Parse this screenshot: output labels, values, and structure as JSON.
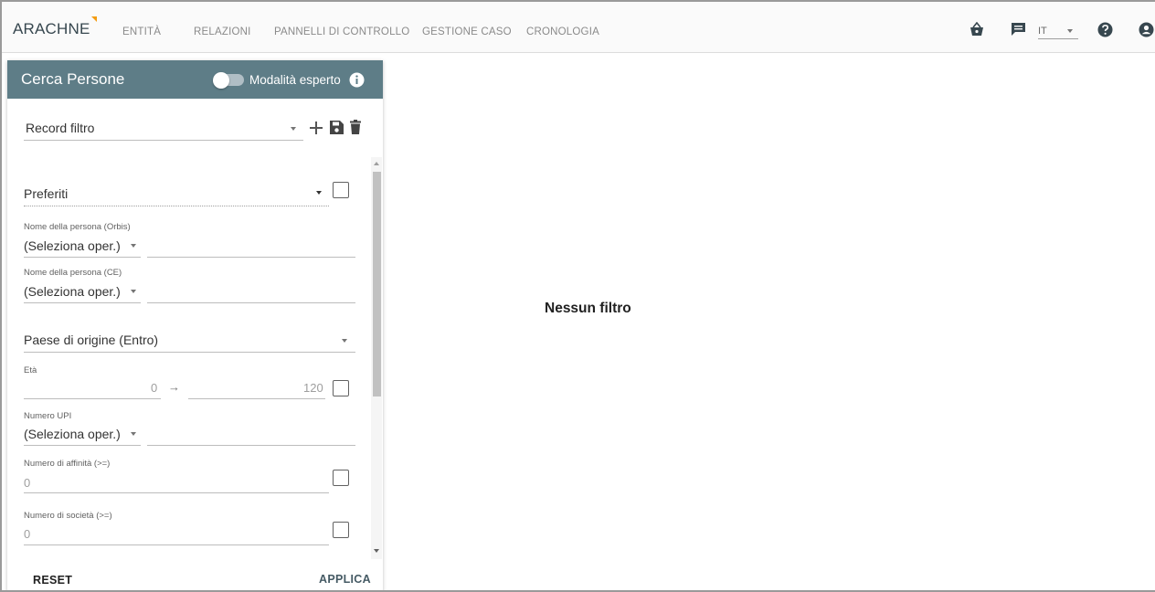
{
  "brand": "ARACHNE",
  "nav": [
    "ENTITÀ",
    "RELAZIONI",
    "PANNELLI DI CONTROLLO",
    "GESTIONE CASO",
    "CRONOLOGIA"
  ],
  "header_icons": [
    "basket-icon",
    "chat-icon",
    "help-icon",
    "account-icon"
  ],
  "language": {
    "value": "IT"
  },
  "panel": {
    "title": "Cerca Persone",
    "expert_label": "Modalità esperto",
    "expert_enabled": false,
    "record_filter_label": "Record filtro",
    "favorites_label": "Preferiti",
    "fields": [
      {
        "label": "Nome della persona (Orbis)",
        "operator": "(Seleziona oper.)"
      },
      {
        "label": "Nome della persona (CE)",
        "operator": "(Seleziona oper.)"
      }
    ],
    "country_label": "Paese di origine (Entro)",
    "age": {
      "label": "Età",
      "min": "0",
      "arrow": "→",
      "max": "120"
    },
    "upi": {
      "label": "Numero UPI",
      "operator": "(Seleziona oper.)"
    },
    "affinity": {
      "label": "Numero di affinità (>=)",
      "value": "0"
    },
    "companies": {
      "label": "Numero di società (>=)",
      "value": "0"
    },
    "reset_label": "RESET",
    "apply_label": "APPLICA"
  },
  "main": {
    "empty_message": "Nessun filtro"
  },
  "colors": {
    "panel_header": "#5e7d87",
    "accent": "#455a64",
    "brand_mark": "#f39c12"
  }
}
